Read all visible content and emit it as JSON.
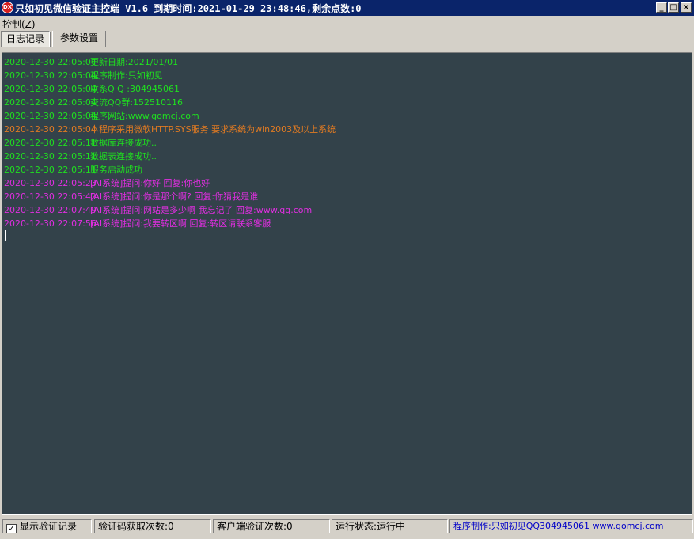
{
  "window": {
    "icon_text": "DX",
    "title": "只如初见微信验证主控端 V1.6 到期时间:2021-01-29 23:48:46,剩余点数:0",
    "min_glyph": "_",
    "max_glyph": "□",
    "close_glyph": "×"
  },
  "menu": {
    "control": "控制(Z)"
  },
  "tabs": [
    {
      "label": "日志记录",
      "active": true
    },
    {
      "label": "参数设置",
      "active": false
    }
  ],
  "log": {
    "colors": {
      "green": "#1fe01f",
      "orange": "#e07a22",
      "magenta": "#e22ee2"
    },
    "lines": [
      {
        "time": "2020-12-30 22:05:04",
        "msg": "更新日期:2021/01/01",
        "color": "green"
      },
      {
        "time": "2020-12-30 22:05:04",
        "msg": "程序制作:只如初见",
        "color": "green"
      },
      {
        "time": "2020-12-30 22:05:04",
        "msg": "联系Q Q :304945061",
        "color": "green"
      },
      {
        "time": "2020-12-30 22:05:04",
        "msg": "交流QQ群:152510116",
        "color": "green"
      },
      {
        "time": "2020-12-30 22:05:04",
        "msg": "程序网站:www.gomcj.com",
        "color": "green"
      },
      {
        "time": "2020-12-30 22:05:04",
        "msg": "本程序采用微软HTTP.SYS服务 要求系统为win2003及以上系统",
        "color": "orange"
      },
      {
        "time": "2020-12-30 22:05:11",
        "msg": "数据库连接成功..",
        "color": "green"
      },
      {
        "time": "2020-12-30 22:05:11",
        "msg": "数据表连接成功..",
        "color": "green"
      },
      {
        "time": "2020-12-30 22:05:11",
        "msg": "服务启动成功",
        "color": "green"
      },
      {
        "time": "2020-12-30 22:05:23",
        "msg": "[AI系统]提问:你好  回复:你也好",
        "color": "magenta"
      },
      {
        "time": "2020-12-30 22:05:42",
        "msg": "[AI系统]提问:你是那个啊?  回复:你猜我是谁",
        "color": "magenta"
      },
      {
        "time": "2020-12-30 22:07:49",
        "msg": "[AI系统]提问:网站是多少啊 我忘记了  回复:www.qq.com",
        "color": "magenta"
      },
      {
        "time": "2020-12-30 22:07:56",
        "msg": "[AI系统]提问:我要转区啊  回复:转区请联系客服",
        "color": "magenta"
      }
    ]
  },
  "status": {
    "show_log_checkbox": {
      "label": "显示验证记录",
      "checked": true,
      "mark": "✓"
    },
    "code_fetch_count": "验证码获取次数:0",
    "client_verify_count": "客户端验证次数:0",
    "run_state": "运行状态:运行中",
    "credit": "程序制作:只如初见QQ304945061 www.gomcj.com"
  }
}
